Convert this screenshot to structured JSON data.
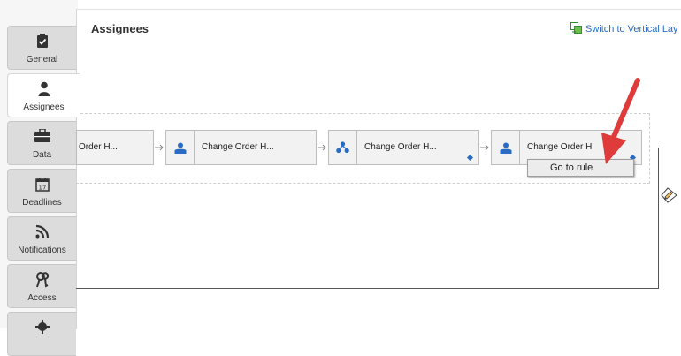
{
  "sidebar": {
    "tabs": [
      {
        "label": "General",
        "icon": "clipboard-check-icon"
      },
      {
        "label": "Assignees",
        "icon": "person-icon"
      },
      {
        "label": "Data",
        "icon": "briefcase-icon"
      },
      {
        "label": "Deadlines",
        "icon": "calendar-icon",
        "calendar_day": "17"
      },
      {
        "label": "Notifications",
        "icon": "rss-feed-icon"
      },
      {
        "label": "Access",
        "icon": "keys-icon"
      }
    ]
  },
  "header": {
    "title": "Assignees",
    "switch_label": "Switch to Vertical Layout",
    "switch_icon": "layout-switch-icon"
  },
  "flow": {
    "nodes": [
      {
        "label": "Order H...",
        "icon": ""
      },
      {
        "label": "Change Order H...",
        "icon": "person-icon"
      },
      {
        "label": "Change Order H...",
        "icon": "group-icon"
      },
      {
        "label": "Change Order H",
        "icon": "person-icon"
      }
    ]
  },
  "context_menu": {
    "items": [
      {
        "label": "Go to rule"
      }
    ]
  },
  "colors": {
    "link": "#2a6cc4",
    "icon_blue": "#2a6cc4",
    "annotation_arrow": "#e03b3b",
    "tab_bg": "#dcdcdc"
  }
}
